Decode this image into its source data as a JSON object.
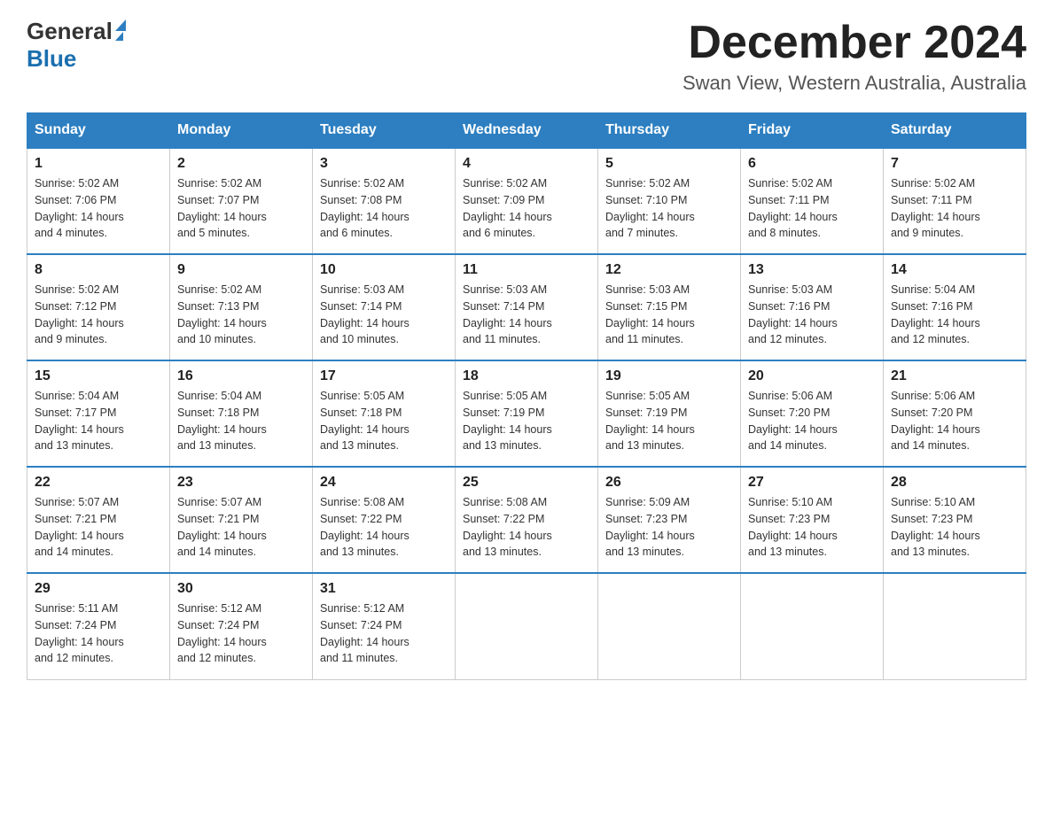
{
  "header": {
    "logo_general": "General",
    "logo_blue": "Blue",
    "month_title": "December 2024",
    "location": "Swan View, Western Australia, Australia"
  },
  "days_of_week": [
    "Sunday",
    "Monday",
    "Tuesday",
    "Wednesday",
    "Thursday",
    "Friday",
    "Saturday"
  ],
  "weeks": [
    [
      {
        "day": "1",
        "sunrise": "5:02 AM",
        "sunset": "7:06 PM",
        "daylight": "14 hours and 4 minutes."
      },
      {
        "day": "2",
        "sunrise": "5:02 AM",
        "sunset": "7:07 PM",
        "daylight": "14 hours and 5 minutes."
      },
      {
        "day": "3",
        "sunrise": "5:02 AM",
        "sunset": "7:08 PM",
        "daylight": "14 hours and 6 minutes."
      },
      {
        "day": "4",
        "sunrise": "5:02 AM",
        "sunset": "7:09 PM",
        "daylight": "14 hours and 6 minutes."
      },
      {
        "day": "5",
        "sunrise": "5:02 AM",
        "sunset": "7:10 PM",
        "daylight": "14 hours and 7 minutes."
      },
      {
        "day": "6",
        "sunrise": "5:02 AM",
        "sunset": "7:11 PM",
        "daylight": "14 hours and 8 minutes."
      },
      {
        "day": "7",
        "sunrise": "5:02 AM",
        "sunset": "7:11 PM",
        "daylight": "14 hours and 9 minutes."
      }
    ],
    [
      {
        "day": "8",
        "sunrise": "5:02 AM",
        "sunset": "7:12 PM",
        "daylight": "14 hours and 9 minutes."
      },
      {
        "day": "9",
        "sunrise": "5:02 AM",
        "sunset": "7:13 PM",
        "daylight": "14 hours and 10 minutes."
      },
      {
        "day": "10",
        "sunrise": "5:03 AM",
        "sunset": "7:14 PM",
        "daylight": "14 hours and 10 minutes."
      },
      {
        "day": "11",
        "sunrise": "5:03 AM",
        "sunset": "7:14 PM",
        "daylight": "14 hours and 11 minutes."
      },
      {
        "day": "12",
        "sunrise": "5:03 AM",
        "sunset": "7:15 PM",
        "daylight": "14 hours and 11 minutes."
      },
      {
        "day": "13",
        "sunrise": "5:03 AM",
        "sunset": "7:16 PM",
        "daylight": "14 hours and 12 minutes."
      },
      {
        "day": "14",
        "sunrise": "5:04 AM",
        "sunset": "7:16 PM",
        "daylight": "14 hours and 12 minutes."
      }
    ],
    [
      {
        "day": "15",
        "sunrise": "5:04 AM",
        "sunset": "7:17 PM",
        "daylight": "14 hours and 13 minutes."
      },
      {
        "day": "16",
        "sunrise": "5:04 AM",
        "sunset": "7:18 PM",
        "daylight": "14 hours and 13 minutes."
      },
      {
        "day": "17",
        "sunrise": "5:05 AM",
        "sunset": "7:18 PM",
        "daylight": "14 hours and 13 minutes."
      },
      {
        "day": "18",
        "sunrise": "5:05 AM",
        "sunset": "7:19 PM",
        "daylight": "14 hours and 13 minutes."
      },
      {
        "day": "19",
        "sunrise": "5:05 AM",
        "sunset": "7:19 PM",
        "daylight": "14 hours and 13 minutes."
      },
      {
        "day": "20",
        "sunrise": "5:06 AM",
        "sunset": "7:20 PM",
        "daylight": "14 hours and 14 minutes."
      },
      {
        "day": "21",
        "sunrise": "5:06 AM",
        "sunset": "7:20 PM",
        "daylight": "14 hours and 14 minutes."
      }
    ],
    [
      {
        "day": "22",
        "sunrise": "5:07 AM",
        "sunset": "7:21 PM",
        "daylight": "14 hours and 14 minutes."
      },
      {
        "day": "23",
        "sunrise": "5:07 AM",
        "sunset": "7:21 PM",
        "daylight": "14 hours and 14 minutes."
      },
      {
        "day": "24",
        "sunrise": "5:08 AM",
        "sunset": "7:22 PM",
        "daylight": "14 hours and 13 minutes."
      },
      {
        "day": "25",
        "sunrise": "5:08 AM",
        "sunset": "7:22 PM",
        "daylight": "14 hours and 13 minutes."
      },
      {
        "day": "26",
        "sunrise": "5:09 AM",
        "sunset": "7:23 PM",
        "daylight": "14 hours and 13 minutes."
      },
      {
        "day": "27",
        "sunrise": "5:10 AM",
        "sunset": "7:23 PM",
        "daylight": "14 hours and 13 minutes."
      },
      {
        "day": "28",
        "sunrise": "5:10 AM",
        "sunset": "7:23 PM",
        "daylight": "14 hours and 13 minutes."
      }
    ],
    [
      {
        "day": "29",
        "sunrise": "5:11 AM",
        "sunset": "7:24 PM",
        "daylight": "14 hours and 12 minutes."
      },
      {
        "day": "30",
        "sunrise": "5:12 AM",
        "sunset": "7:24 PM",
        "daylight": "14 hours and 12 minutes."
      },
      {
        "day": "31",
        "sunrise": "5:12 AM",
        "sunset": "7:24 PM",
        "daylight": "14 hours and 11 minutes."
      },
      null,
      null,
      null,
      null
    ]
  ],
  "labels": {
    "sunrise_prefix": "Sunrise: ",
    "sunset_prefix": "Sunset: ",
    "daylight_prefix": "Daylight: "
  }
}
